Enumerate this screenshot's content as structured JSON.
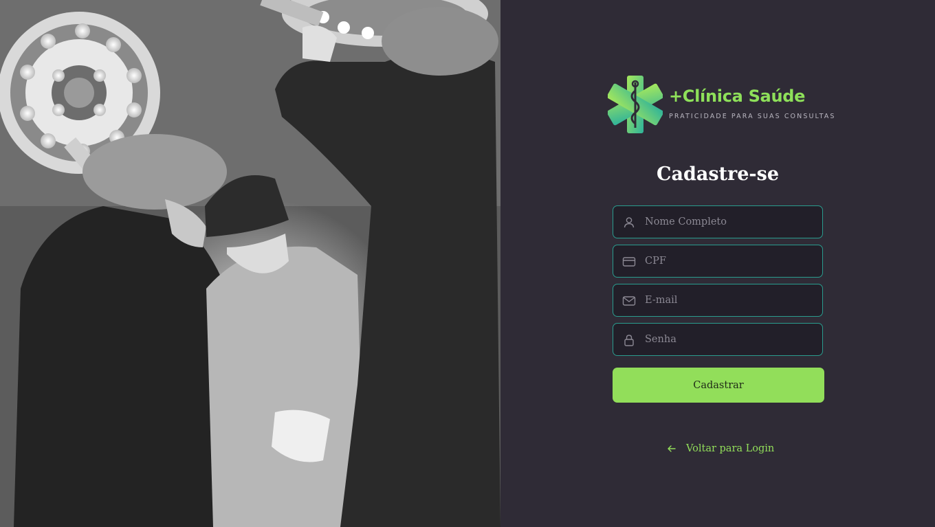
{
  "brand": {
    "name": "+Clínica Saúde",
    "tagline": "PRATICIDADE PARA SUAS CONSULTAS",
    "logo_icon": "star-of-life-caduceus-icon",
    "accent_color": "#92de5a",
    "secondary_color": "#2a9d8f"
  },
  "form": {
    "title": "Cadastre-se",
    "fields": {
      "name": {
        "placeholder": "Nome Completo",
        "value": "",
        "icon": "user-icon"
      },
      "cpf": {
        "placeholder": "CPF",
        "value": "",
        "icon": "id-card-icon"
      },
      "email": {
        "placeholder": "E-mail",
        "value": "",
        "icon": "mail-icon"
      },
      "password": {
        "placeholder": "Senha",
        "value": "",
        "icon": "lock-icon"
      }
    },
    "submit_label": "Cadastrar",
    "back_link_label": "Voltar para Login",
    "back_link_icon": "arrow-left-icon"
  },
  "hero_image": {
    "style": "grayscale"
  },
  "colors": {
    "panel_background": "#2f2b36",
    "field_background": "#221f29",
    "field_border": "#2a9d8f",
    "button_background": "#92de5a"
  }
}
